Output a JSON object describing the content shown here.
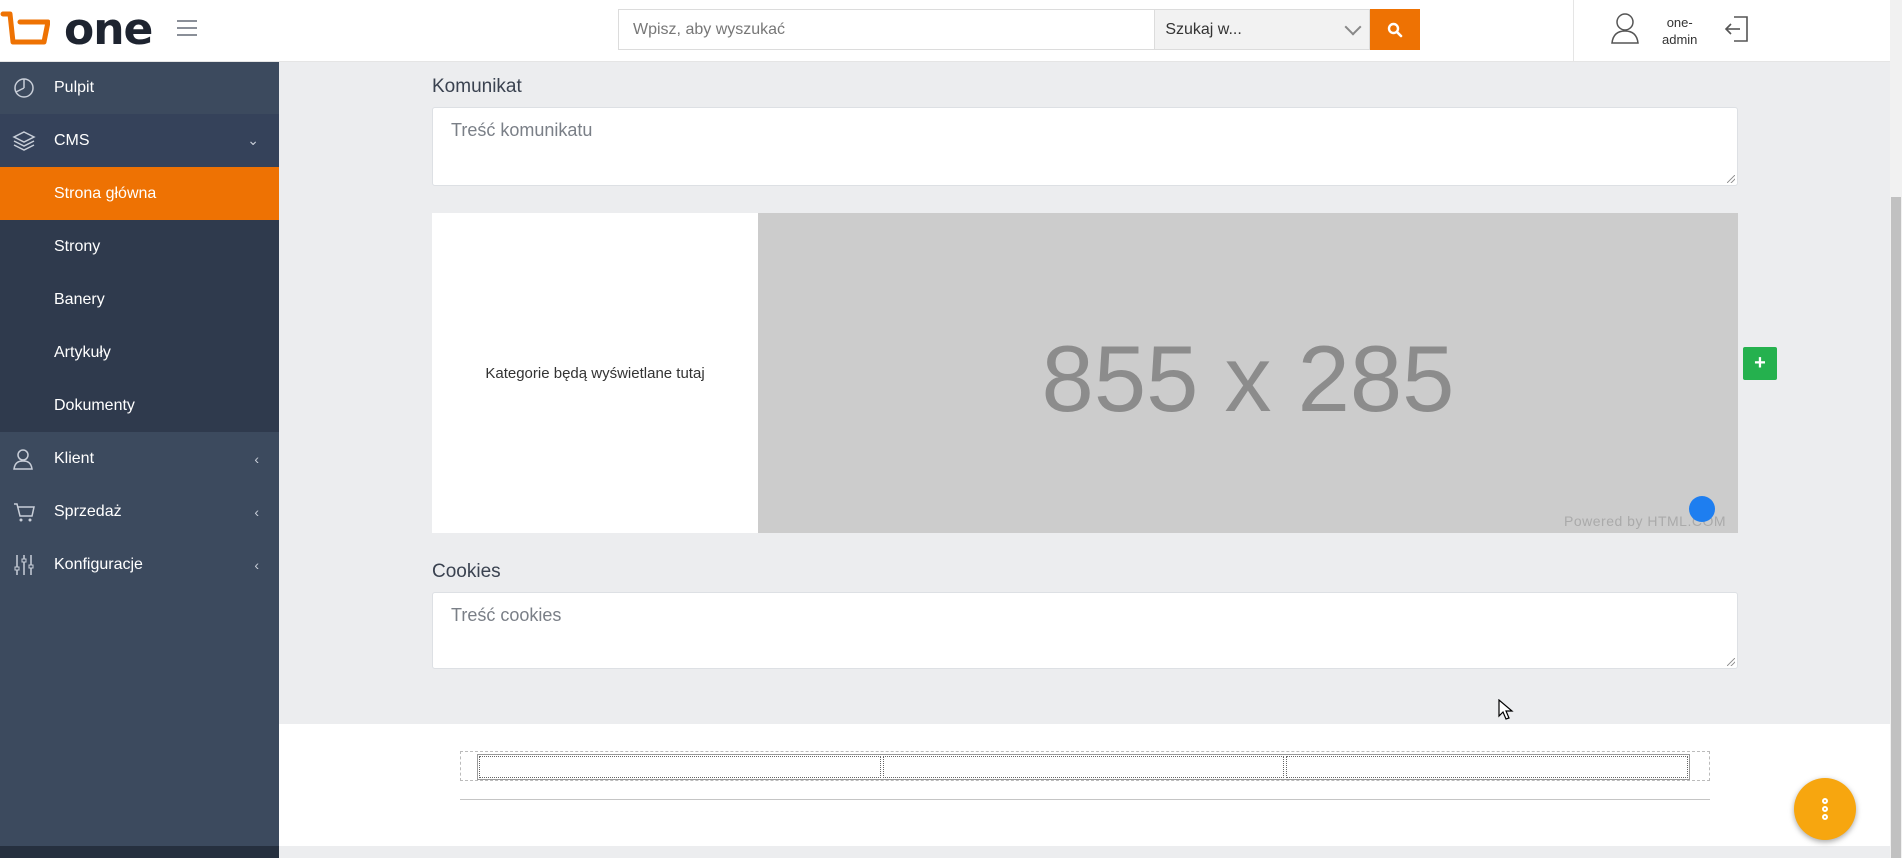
{
  "header": {
    "logo_text": "one",
    "search_placeholder": "Wpisz, aby wyszukać",
    "search_scope": "Szukaj w...",
    "user_name_line1": "one-",
    "user_name_line2": "admin"
  },
  "sidebar": {
    "items": [
      {
        "label": "Pulpit",
        "icon": "dashboard-icon"
      },
      {
        "label": "CMS",
        "icon": "layers-icon",
        "caret": "⌄"
      },
      {
        "label": "Klient",
        "icon": "user-icon",
        "caret": "‹"
      },
      {
        "label": "Sprzedaż",
        "icon": "cart-icon",
        "caret": "‹"
      },
      {
        "label": "Konfiguracje",
        "icon": "sliders-icon",
        "caret": "‹"
      }
    ],
    "cms_sub": [
      "Strona główna",
      "Strony",
      "Banery",
      "Artykuły",
      "Dokumenty"
    ]
  },
  "main": {
    "komunikat_label": "Komunikat",
    "komunikat_placeholder": "Treść komunikatu",
    "categories_text": "Kategorie będą wyświetlane tutaj",
    "placeholder_dim": "855 x 285",
    "placeholder_powered": "Powered by HTML.COM",
    "add_label": "+",
    "cookies_label": "Cookies",
    "cookies_placeholder": "Treść cookies"
  },
  "colors": {
    "accent": "#ee7203",
    "sidebar": "#3c4a5e",
    "add_button": "#25b14e",
    "fab": "#f7a60f"
  }
}
